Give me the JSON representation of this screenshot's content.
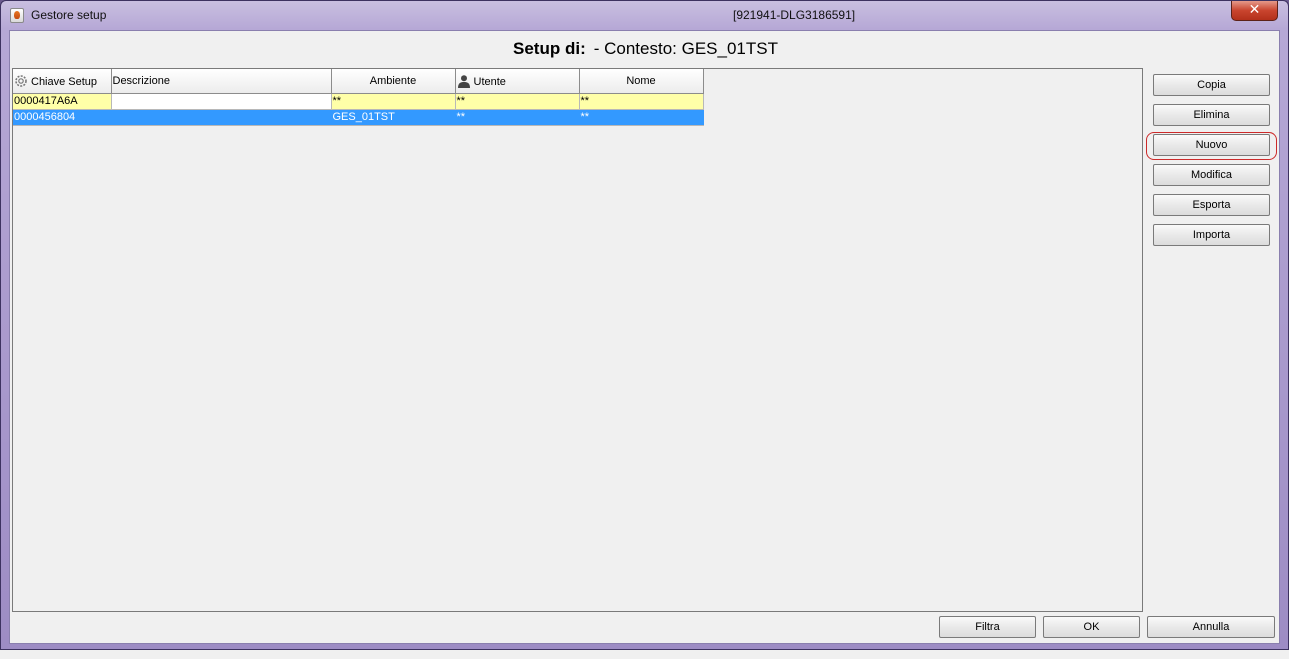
{
  "window": {
    "title": "Gestore setup",
    "id_label": "[921941-DLG3186591]",
    "close_glyph": "✕"
  },
  "heading": {
    "label": "Setup di:",
    "context": "- Contesto: GES_01TST"
  },
  "table": {
    "columns": [
      {
        "key": "chiave",
        "label": "Chiave Setup",
        "icon": "gear-icon"
      },
      {
        "key": "descrizione",
        "label": "Descrizione"
      },
      {
        "key": "ambiente",
        "label": "Ambiente"
      },
      {
        "key": "utente",
        "label": "Utente",
        "icon": "user-icon"
      },
      {
        "key": "nome",
        "label": "Nome"
      }
    ],
    "rows": [
      {
        "chiave": "0000417A6A",
        "descrizione": "",
        "ambiente": "**",
        "utente": "**",
        "nome": "**"
      },
      {
        "chiave": "0000456804",
        "descrizione": "",
        "ambiente": "GES_01TST",
        "utente": "**",
        "nome": "**"
      }
    ]
  },
  "side_buttons": {
    "copia": "Copia",
    "elimina": "Elimina",
    "nuovo": "Nuovo",
    "modifica": "Modifica",
    "esporta": "Esporta",
    "importa": "Importa"
  },
  "bottom_buttons": {
    "filtra": "Filtra",
    "ok": "OK",
    "annulla": "Annulla"
  },
  "colors": {
    "selected_row": "#3399ff",
    "highlight_row": "#ffffa8",
    "highlight_ring": "#cc2a2a"
  }
}
